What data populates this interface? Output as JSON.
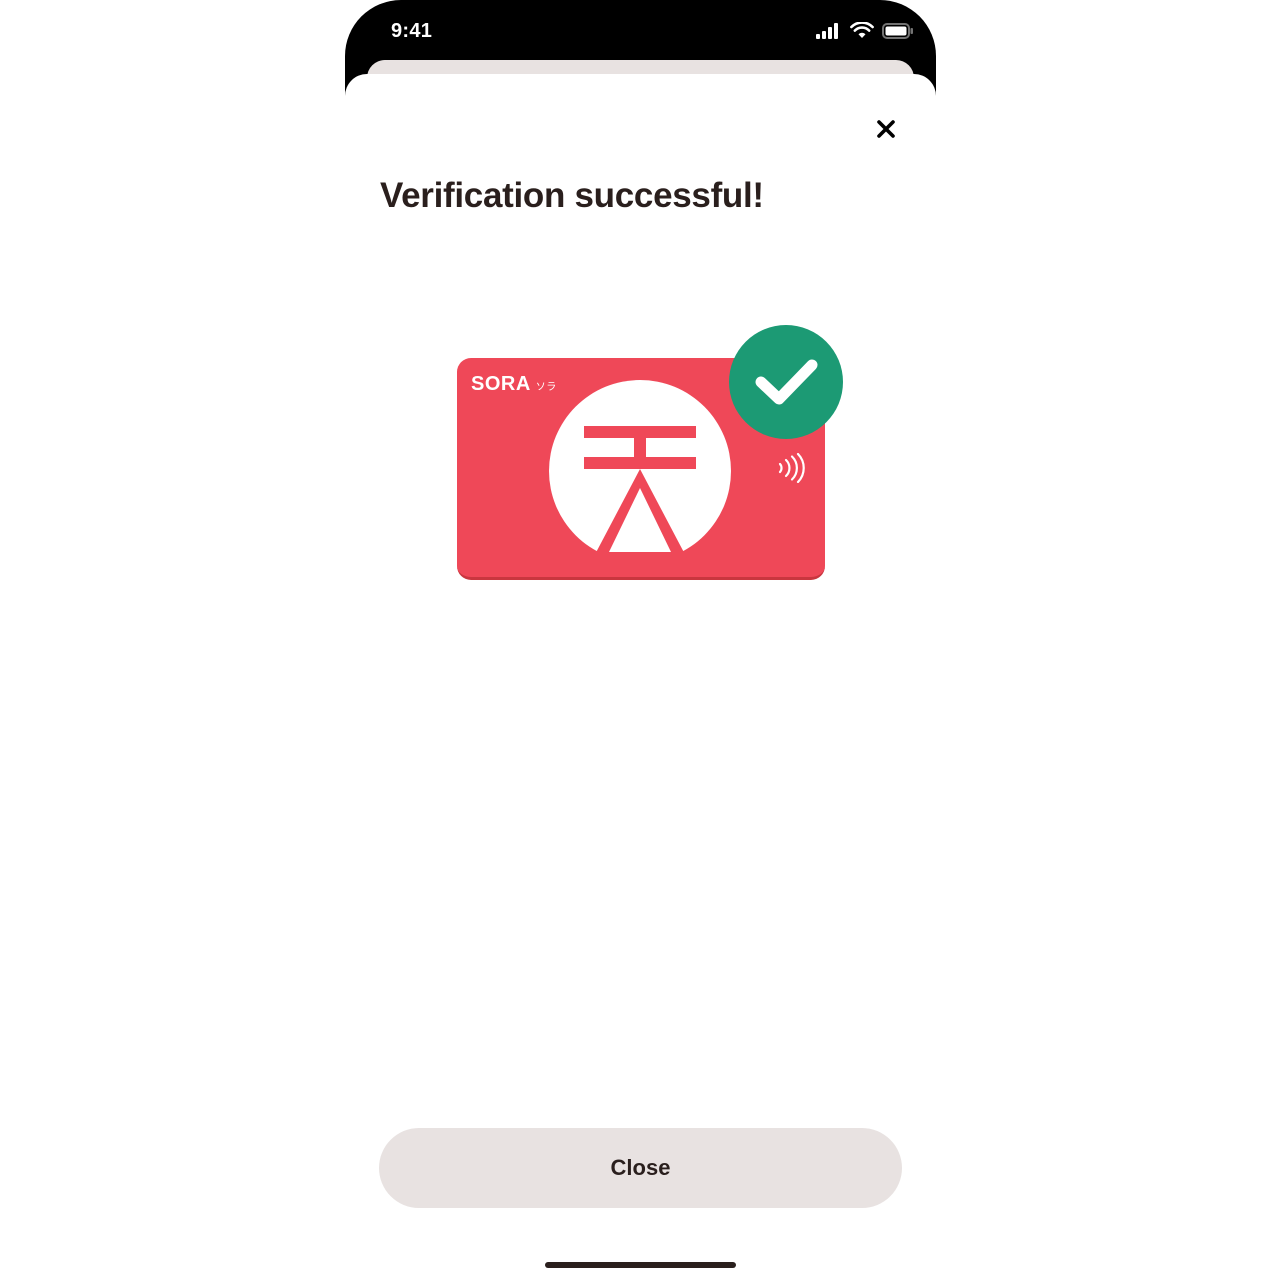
{
  "status_bar": {
    "time": "9:41",
    "icons": [
      "cellular-signal-icon",
      "wifi-icon",
      "battery-icon"
    ]
  },
  "sheet": {
    "close_icon": "close-icon",
    "title": "Verification successful!",
    "card": {
      "brand": "SORA",
      "brand_sub": "ソラ",
      "logo_glyph": "天",
      "nfc_icon": "contactless-icon",
      "color": "#ef4858"
    },
    "badge": {
      "icon": "check-icon",
      "color": "#1c9a74"
    },
    "close_button_label": "Close"
  },
  "colors": {
    "text": "#2a1f1d",
    "button_bg": "#e8e2e1"
  }
}
